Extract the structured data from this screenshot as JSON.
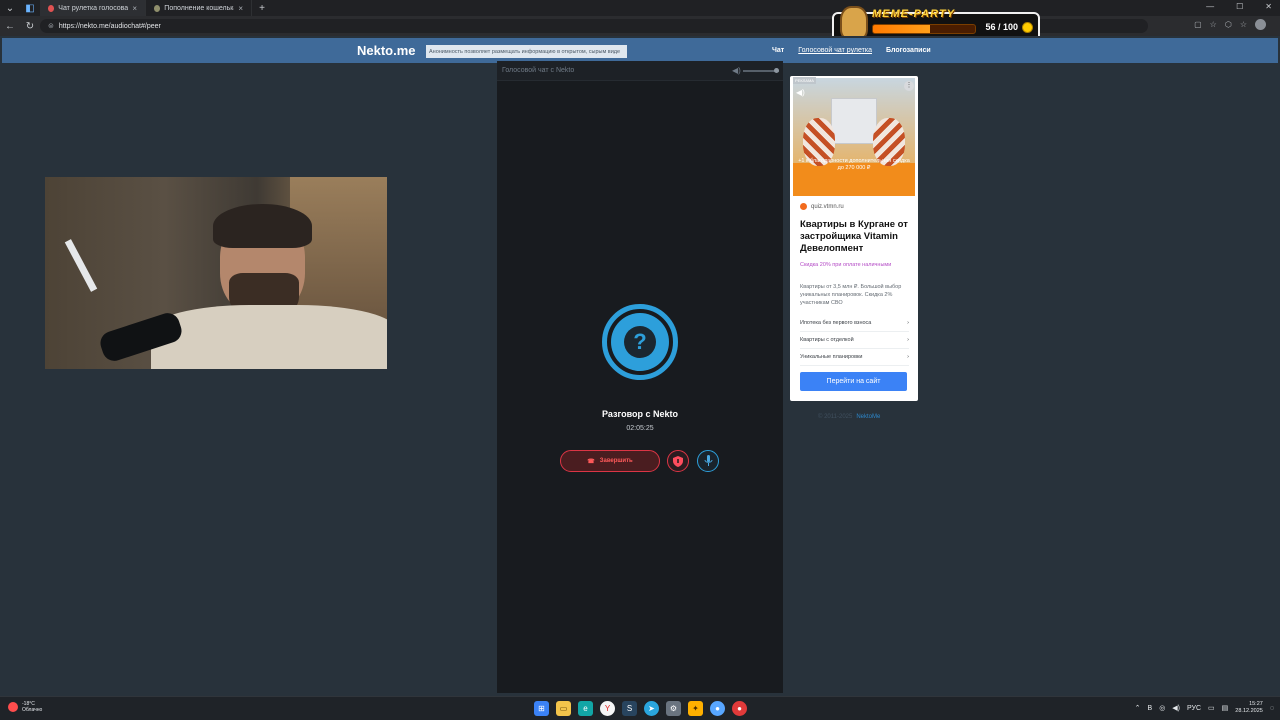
{
  "browser": {
    "tabs": [
      {
        "label": "Чат рулетка голосовая — H",
        "close": "×",
        "icon_color": "#e05252"
      },
      {
        "label": "Пополнение кошелька | Dragon",
        "close": "×",
        "icon_color": "#8f8f6c"
      }
    ],
    "new_tab_icon": "+",
    "address": "https://nekto.me/audiochat#/peer",
    "window_controls": [
      "—",
      "☐",
      "✕"
    ]
  },
  "meme_party": {
    "title": "MEME-PARTY",
    "progress": 0.56,
    "count": "56 / 100"
  },
  "site": {
    "logo": "Nekto.me",
    "notice": "Анонимность позволяет размещать информацию в открытом, сырым виде",
    "nav": {
      "chat": "Чат",
      "voice_roulette": "Голосовой чат рулетка",
      "blog": "Блогозаписи"
    }
  },
  "voice_chat": {
    "panel_title": "Голосовой чат с Nekto",
    "volume_level": 1,
    "conversation_title": "Разговор с Nekto",
    "timer": "02:05:25",
    "end_button": "Завершить",
    "avatar_icon": "question-mark-icon"
  },
  "ad": {
    "badge": "РЕКЛАМА",
    "banner_text": "+1 к благодарности дополнительная скидка до 270 000 ₽",
    "source": "quiz.vtmn.ru",
    "title": "Квартиры в Кургане от застройщика Vitamin Девелопмент",
    "discount": "Скидка 20% при оплате наличными",
    "description": "Квартиры от 3,5 млн ₽. Большой выбор уникальных планировок. Скидка 2% участникам СВО",
    "links": [
      "Ипотека без первого взноса",
      "Квартиры с отделкой",
      "Уникальные планировки"
    ],
    "link_arrow": "›",
    "cta": "Перейти на сайт"
  },
  "footer": {
    "copyright": "© 2011-2025",
    "brand": "NektoMe"
  },
  "taskbar": {
    "weather_temp": "-18°C",
    "weather_desc": "Облачно",
    "icons": [
      {
        "name": "start",
        "color": "#3b82f6",
        "glyph": "⊞"
      },
      {
        "name": "explorer",
        "color": "#f3c44b",
        "glyph": "▭"
      },
      {
        "name": "edge",
        "color": "#12a6a6",
        "glyph": "e"
      },
      {
        "name": "yandex",
        "color": "#f5f5f5",
        "glyph": "Y"
      },
      {
        "name": "steam",
        "color": "#28445e",
        "glyph": "S"
      },
      {
        "name": "telegram",
        "color": "#2aa6de",
        "glyph": "➤"
      },
      {
        "name": "settings",
        "color": "#6a7480",
        "glyph": "⚙"
      },
      {
        "name": "app",
        "color": "#ffb000",
        "glyph": "✦"
      },
      {
        "name": "droplet",
        "color": "#58a6ff",
        "glyph": "●"
      },
      {
        "name": "notification-app",
        "color": "#e03a3a",
        "glyph": "●"
      }
    ],
    "tray_lang": "РУС",
    "time": "15:27",
    "date": "28.12.2025"
  }
}
